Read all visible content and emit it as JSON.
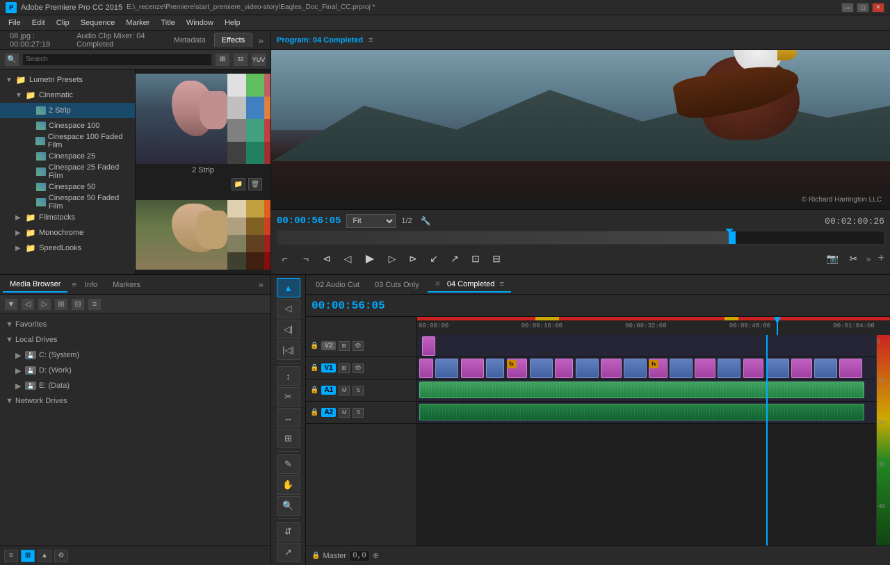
{
  "titlebar": {
    "app_name": "Adobe Premiere Pro CC 2015",
    "project_path": "E:\\_recenze\\Premiere\\start_premiere_video-story\\Eagles_Doc_Final_CC.prproj *",
    "minimize": "—",
    "maximize": "□",
    "close": "✕"
  },
  "menubar": {
    "items": [
      "File",
      "Edit",
      "Clip",
      "Sequence",
      "Marker",
      "Title",
      "Window",
      "Help"
    ]
  },
  "top_tabs": {
    "source_label": "08.jpg : 00:00:27:19",
    "mixer_label": "Audio Clip Mixer: 04 Completed",
    "metadata_label": "Metadata",
    "effects_label": "Effects",
    "overflow": "»"
  },
  "effects_panel": {
    "search_placeholder": "Search",
    "toolbar_btns": [
      "⊞",
      "32",
      "YUV"
    ],
    "tree": [
      {
        "level": 0,
        "arrow": "▼",
        "hasFolder": true,
        "label": "Lumetri Presets",
        "indent": 0
      },
      {
        "level": 1,
        "arrow": "▼",
        "hasFolder": true,
        "label": "Cinematic",
        "indent": 1
      },
      {
        "level": 2,
        "arrow": "",
        "hasFolder": false,
        "label": "2 Strip",
        "indent": 2
      },
      {
        "level": 2,
        "arrow": "",
        "hasFolder": false,
        "label": "Cinespace 100",
        "indent": 2
      },
      {
        "level": 2,
        "arrow": "",
        "hasFolder": false,
        "label": "Cinespace 100 Faded Film",
        "indent": 2
      },
      {
        "level": 2,
        "arrow": "",
        "hasFolder": false,
        "label": "Cinespace 25",
        "indent": 2
      },
      {
        "level": 2,
        "arrow": "",
        "hasFolder": false,
        "label": "Cinespace 25 Faded Film",
        "indent": 2
      },
      {
        "level": 2,
        "arrow": "",
        "hasFolder": false,
        "label": "Cinespace 50",
        "indent": 2
      },
      {
        "level": 2,
        "arrow": "",
        "hasFolder": false,
        "label": "Cinespace 50 Faded Film",
        "indent": 2
      },
      {
        "level": 1,
        "arrow": "▶",
        "hasFolder": true,
        "label": "Filmstocks",
        "indent": 1
      },
      {
        "level": 1,
        "arrow": "▶",
        "hasFolder": true,
        "label": "Monochrome",
        "indent": 1
      },
      {
        "level": 1,
        "arrow": "▶",
        "hasFolder": true,
        "label": "SpeedLooks",
        "indent": 1
      }
    ],
    "preview1_label": "2 Strip",
    "preview2_label": "",
    "folder_btn": "📁",
    "trash_btn": "🗑"
  },
  "program_monitor": {
    "title": "Program: 04 Completed",
    "menu_icon": "≡",
    "timecode": "00:00:56:05",
    "fit_label": "Fit",
    "fraction": "1/2",
    "wrench": "🔧",
    "duration": "00:02:00:26",
    "watermark": "© Richard Harrington LLC",
    "controls": {
      "mark_in": "⌐",
      "mark_out": "¬",
      "go_in": "⊲",
      "step_back": "◁",
      "play": "▶",
      "step_fwd": "▷",
      "go_out": "⊳",
      "insert": "↙",
      "overwrite": "↗",
      "lift": "⊡",
      "extract": "⊟",
      "more": "»",
      "add": "+"
    }
  },
  "bottom_panels": {
    "media_browser_label": "Media Browser",
    "info_label": "Info",
    "markers_label": "Markers",
    "overflow": "»",
    "menu_icon": "≡",
    "favorites_label": "Favorites",
    "local_drives_label": "Local Drives",
    "c_drive": "C: (System)",
    "d_drive": "D: (Work)",
    "e_drive": "E: (Data)",
    "network_drives_label": "Network Drives"
  },
  "timeline": {
    "tab1_label": "02 Audio Cut",
    "tab2_label": "03 Cuts Only",
    "tab3_label": "04 Completed",
    "tab3_close": "✕",
    "tab3_menu": "≡",
    "timecode": "00:00:56:05",
    "ruler_times": [
      "00:00:00",
      "00:00:16:00",
      "00:00:32:00",
      "00:00:48:00",
      "00:01:04:00"
    ],
    "tracks": {
      "v2": "V2",
      "v1": "V1",
      "a1": "A1",
      "a2": "A2"
    },
    "master_label": "Master",
    "master_timecode": "0,0",
    "master_icon": "⊕"
  },
  "vu_labels": [
    "-12",
    "-24",
    "-36",
    "-48"
  ],
  "tools": {
    "select": "▲",
    "pen": "✎",
    "ripple": "◁|",
    "roll": "|▷◁|",
    "rate": "↕",
    "slip": "◁▷",
    "slide": "◁◁",
    "razor": "✂",
    "hand": "✋",
    "zoom": "🔍",
    "t1": "⇵",
    "t2": "↔",
    "t3": "⊞",
    "t4": "↗"
  }
}
